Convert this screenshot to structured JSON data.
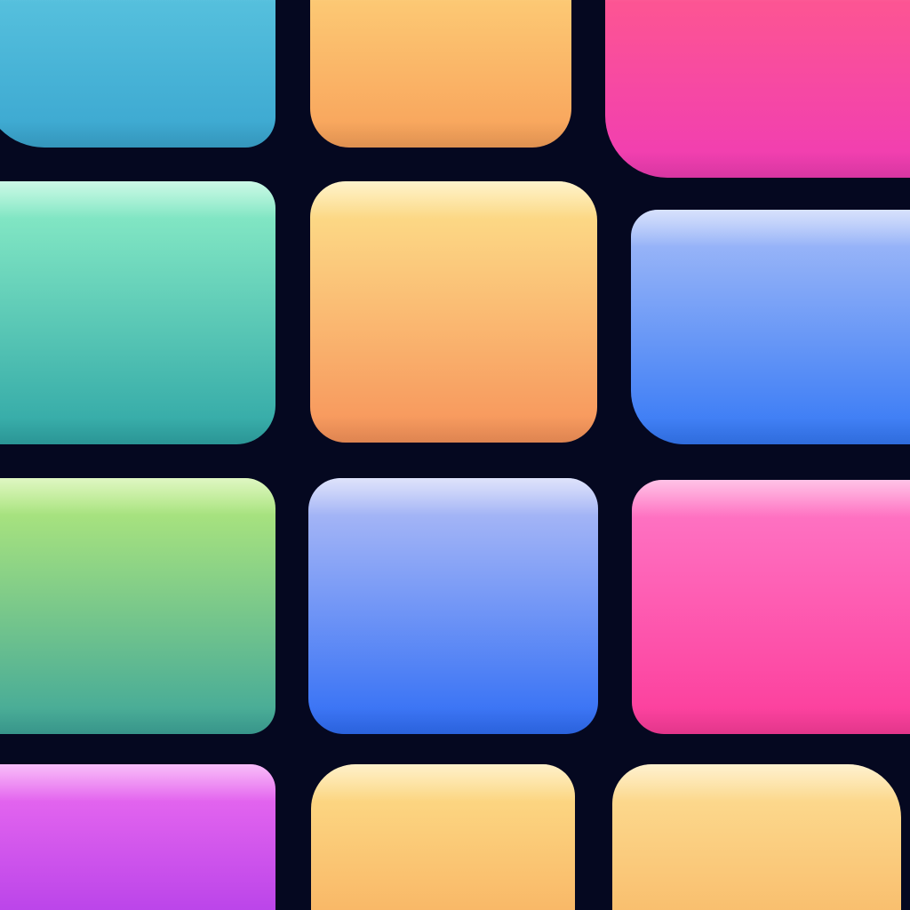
{
  "background_color": "#050820",
  "tiles": [
    {
      "id": "t1",
      "name": "tile-cyan",
      "top_color": "#5cc6e0",
      "bottom_color": "#3aa6d0"
    },
    {
      "id": "t2",
      "name": "tile-peach",
      "top_color": "#fdd27a",
      "bottom_color": "#f8a15a"
    },
    {
      "id": "t3",
      "name": "tile-pink",
      "top_color": "#ff5a8c",
      "bottom_color": "#f03cb4"
    },
    {
      "id": "t4",
      "name": "tile-mint",
      "top_color": "#8ef0c8",
      "bottom_color": "#2fa6a6"
    },
    {
      "id": "t5",
      "name": "tile-orange",
      "top_color": "#fde38c",
      "bottom_color": "#f7935a"
    },
    {
      "id": "t6",
      "name": "tile-blue",
      "top_color": "#a8bef8",
      "bottom_color": "#3478f5"
    },
    {
      "id": "t7",
      "name": "tile-green",
      "top_color": "#b8ec7a",
      "bottom_color": "#3ea69a"
    },
    {
      "id": "t8",
      "name": "tile-periwinkle",
      "top_color": "#b6c0f6",
      "bottom_color": "#2f6df5"
    },
    {
      "id": "t9",
      "name": "tile-magenta",
      "top_color": "#ff7ac8",
      "bottom_color": "#fc3c9a"
    },
    {
      "id": "t10",
      "name": "tile-violet",
      "top_color": "#ef6ef0",
      "bottom_color": "#b03ce8"
    },
    {
      "id": "t11",
      "name": "tile-apricot",
      "top_color": "#fddf8a",
      "bottom_color": "#f8b060"
    },
    {
      "id": "t12",
      "name": "tile-sand",
      "top_color": "#fde096",
      "bottom_color": "#f8b866"
    }
  ]
}
